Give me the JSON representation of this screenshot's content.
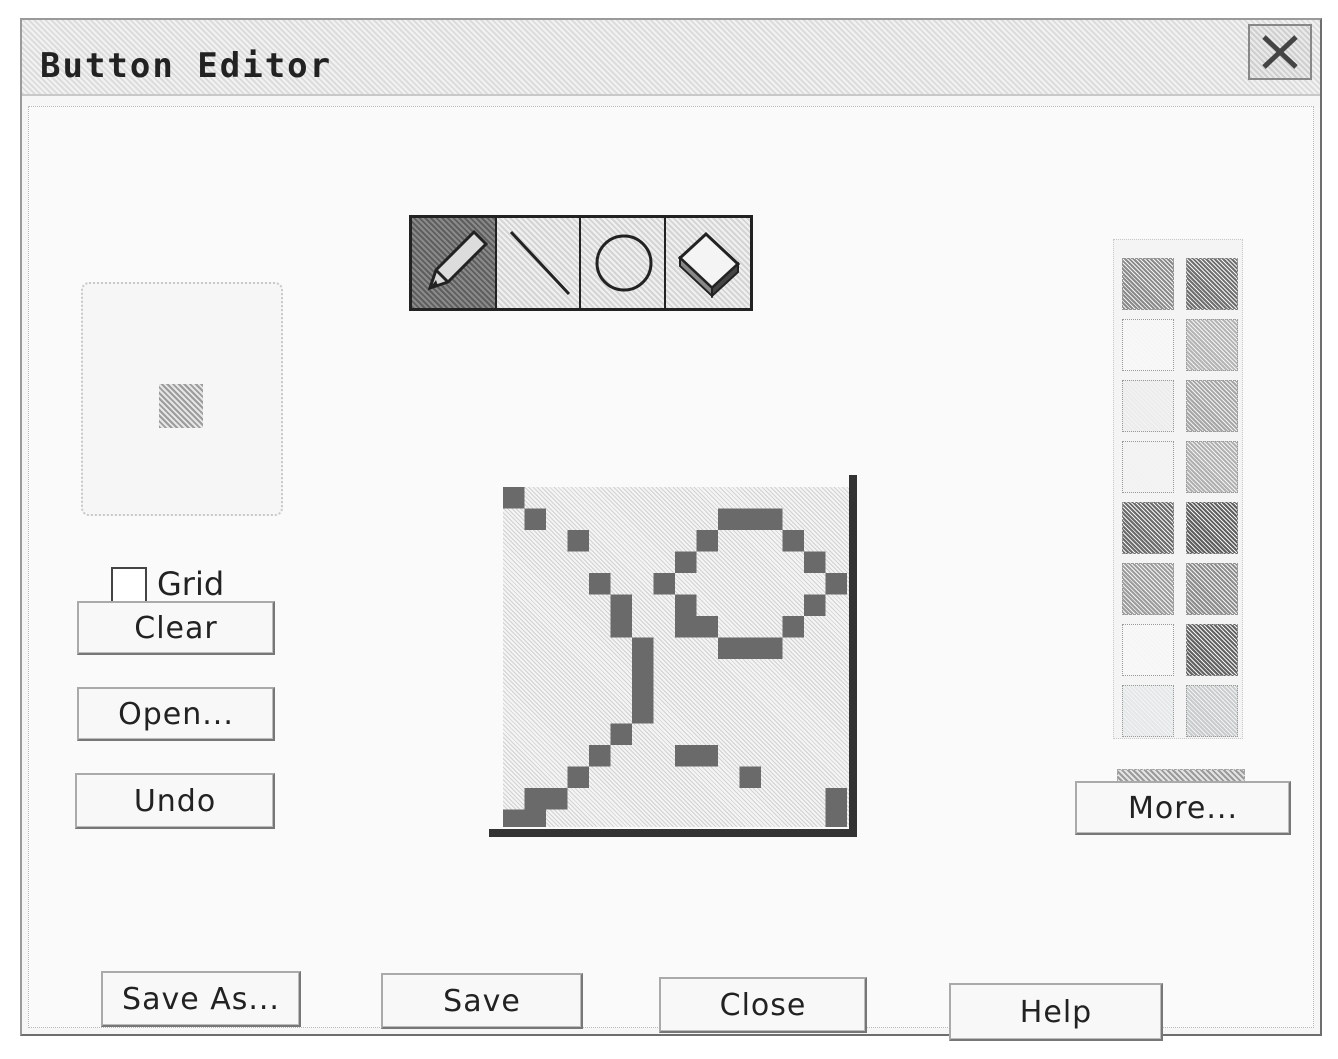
{
  "window": {
    "title": "Button Editor"
  },
  "preview": {
    "icon": "button-preview-icon"
  },
  "grid": {
    "label": "Grid",
    "checked": false
  },
  "buttons": {
    "clear": "Clear",
    "open": "Open...",
    "undo": "Undo",
    "more": "More...",
    "save_as": "Save As...",
    "save": "Save",
    "close": "Close",
    "help": "Help"
  },
  "tools": [
    {
      "name": "pencil-icon",
      "active": true
    },
    {
      "name": "line-icon",
      "active": false
    },
    {
      "name": "circle-icon",
      "active": false
    },
    {
      "name": "eraser-icon",
      "active": false
    }
  ],
  "colors": {
    "dark": "#5a5a5a",
    "mid": "#8c8c8c",
    "light": "#d8d8d8"
  }
}
